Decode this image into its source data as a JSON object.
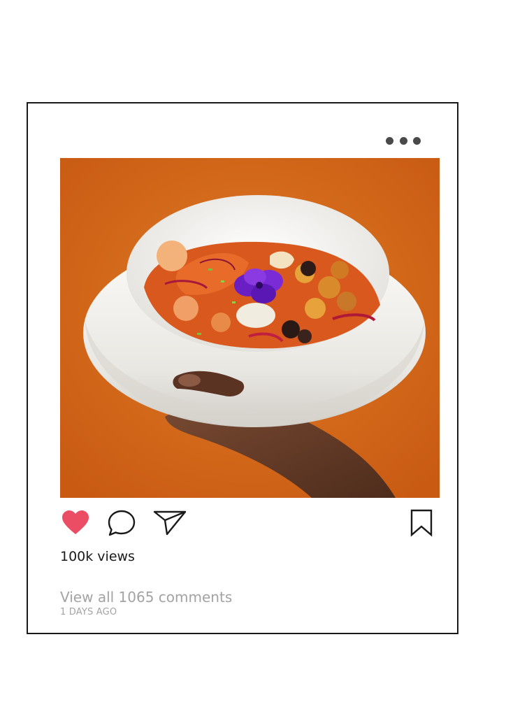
{
  "post": {
    "views": "100k views",
    "comments_link": "View all 1065 comments",
    "timestamp": "1 DAYS AGO",
    "liked": true
  },
  "icons": {
    "more": "more-horizontal-icon",
    "like": "heart-icon",
    "comment": "comment-icon",
    "share": "send-icon",
    "save": "bookmark-icon"
  },
  "colors": {
    "like": "#ea4d64",
    "photo_background": "#d86a1c",
    "muted_text": "#a3a3a3",
    "border": "#1a1a1a"
  }
}
